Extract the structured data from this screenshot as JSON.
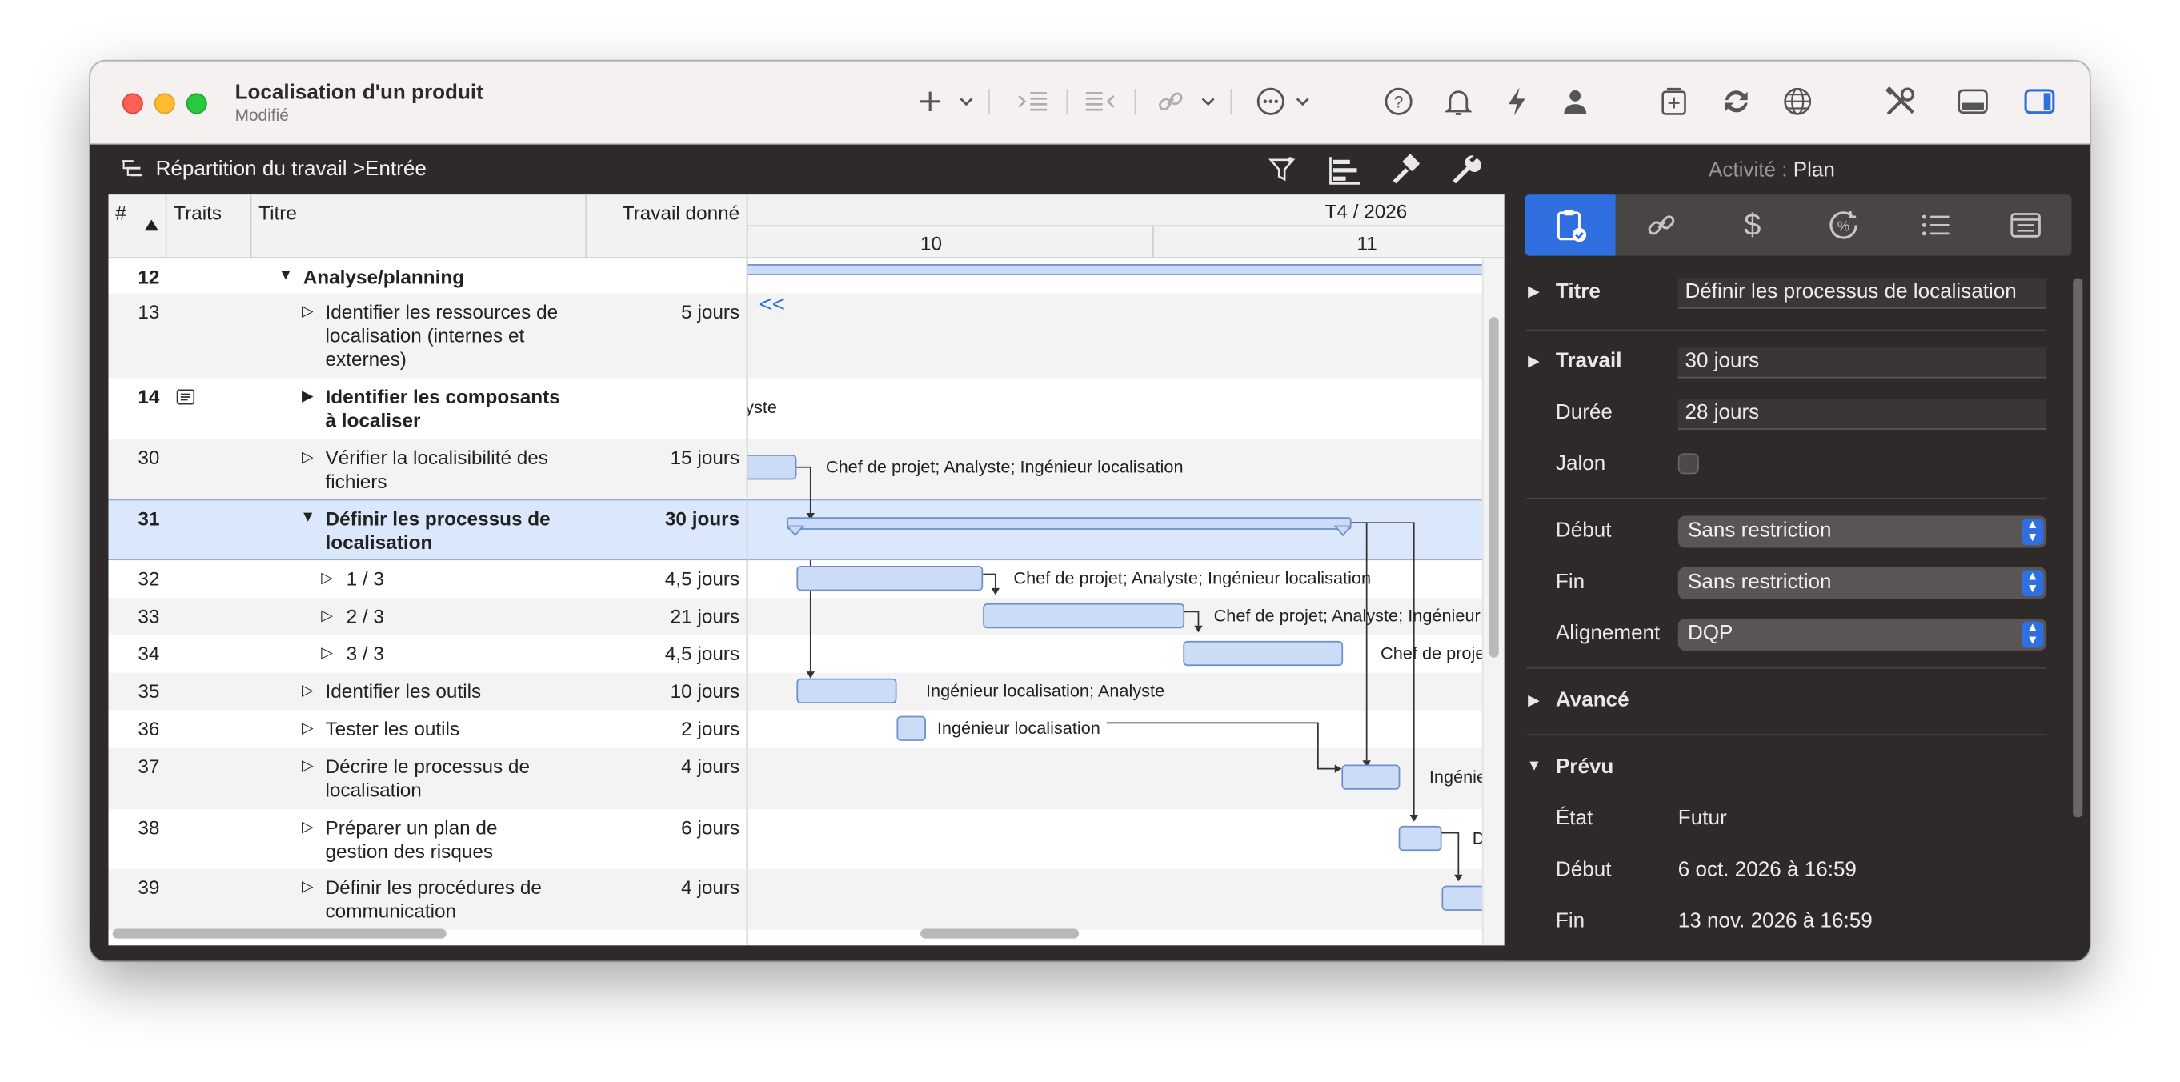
{
  "window": {
    "title": "Localisation d'un produit",
    "subtitle": "Modifié"
  },
  "toolbar_icons": [
    "plus-icon",
    "chevron-down-icon",
    "indent-icon",
    "outdent-icon",
    "link-icon",
    "chevron-down-icon",
    "more-icon",
    "chevron-down-icon",
    "help-icon",
    "bell-icon",
    "bolt-icon",
    "person-icon",
    "add-doc-icon",
    "sync-icon",
    "globe-icon",
    "tools-icon",
    "bottom-panel-icon",
    "side-panel-icon"
  ],
  "breadcrumb": {
    "view": "Répartition du travail",
    "separator": ">",
    "current": "Entrée"
  },
  "activity": {
    "label": "Activité :",
    "value": "Plan"
  },
  "outline": {
    "headers": {
      "num": "#",
      "traits": "Traits",
      "title": "Titre",
      "work": "Travail donné"
    },
    "rows": [
      {
        "num": "12",
        "title": "Analyse/planning",
        "work": "",
        "bold": true,
        "expanded": true
      },
      {
        "num": "13",
        "title": "Identifier les ressources de",
        "title2": "localisation (internes et",
        "title3": "externes)",
        "work": "5 jours"
      },
      {
        "num": "14",
        "title": "Identifier les composants",
        "title2": "à localiser",
        "work": "",
        "bold": true
      },
      {
        "num": "30",
        "title": "Vérifier la localisibilité des",
        "title2": "fichiers",
        "work": "15 jours"
      },
      {
        "num": "31",
        "title": "Définir les processus de",
        "title2": "localisation",
        "work": "30 jours",
        "bold": true,
        "expanded": true,
        "selected": true
      },
      {
        "num": "32",
        "title": "1 / 3",
        "work": "4,5 jours"
      },
      {
        "num": "33",
        "title": "2 / 3",
        "work": "21 jours"
      },
      {
        "num": "34",
        "title": "3 / 3",
        "work": "4,5 jours"
      },
      {
        "num": "35",
        "title": "Identifier les outils",
        "work": "10 jours"
      },
      {
        "num": "36",
        "title": "Tester les outils",
        "work": "2 jours"
      },
      {
        "num": "37",
        "title": "Décrire le processus de",
        "title2": "localisation",
        "work": "4 jours"
      },
      {
        "num": "38",
        "title": "Préparer un plan de",
        "title2": "gestion des risques",
        "work": "6 jours"
      },
      {
        "num": "39",
        "title": "Définir les procédures de",
        "title2": "communication",
        "work": "4 jours"
      }
    ]
  },
  "gantt": {
    "quarter": "T4 / 2026",
    "weeks": [
      "10",
      "11"
    ],
    "labels": {
      "r13": "<<",
      "r14": "yste",
      "r30": "Chef de projet; Analyste; Ingénieur localisation",
      "r32": "Chef de projet; Analyste; Ingénieur localisation",
      "r33": "Chef de projet; Analyste; Ingénieur",
      "r34": "Chef de proje",
      "r35": "Ingénieur localisation; Analyste",
      "r36": "Ingénieur localisation",
      "r37": "Ingénie",
      "r38": "D"
    }
  },
  "inspector": {
    "tab_icons": [
      "clipboard-check-icon",
      "link-icon",
      "dollar-icon",
      "percent-gauge-icon",
      "list-icon",
      "notes-icon"
    ],
    "titre": {
      "label": "Titre",
      "value": "Définir les processus de localisation"
    },
    "travail": {
      "label": "Travail",
      "value": "30 jours"
    },
    "duree": {
      "label": "Durée",
      "value": "28 jours"
    },
    "jalon": {
      "label": "Jalon",
      "checked": false
    },
    "debut": {
      "label": "Début",
      "value": "Sans restriction"
    },
    "fin": {
      "label": "Fin",
      "value": "Sans restriction"
    },
    "alignement": {
      "label": "Alignement",
      "value": "DQP"
    },
    "avance": {
      "label": "Avancé"
    },
    "prevu": {
      "label": "Prévu",
      "etat_label": "État",
      "etat_value": "Futur",
      "debut_label": "Début",
      "debut_value": "6 oct. 2026 à 16:59",
      "fin_label": "Fin",
      "fin_value": "13 nov. 2026 à 16:59"
    }
  },
  "colors": {
    "close": "#fe5f57",
    "minimize": "#febc2e",
    "zoom": "#28c840",
    "accent": "#2f6fe0",
    "bar_fill": "#cddcf6",
    "bar_border": "#6d8fcb",
    "selection": "#dbe7fa"
  }
}
